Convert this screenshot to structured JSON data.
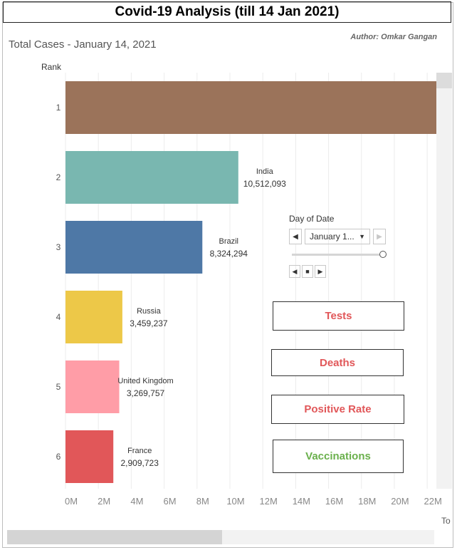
{
  "header": {
    "title": "Covid-19 Analysis (till 14 Jan 2021)",
    "author": "Author: Omkar Gangan",
    "subtitle": "Total Cases - January 14, 2021"
  },
  "chart_data": {
    "type": "bar",
    "orientation": "horizontal",
    "y_axis_title": "Rank",
    "categories": [
      "1",
      "2",
      "3",
      "4",
      "5",
      "6"
    ],
    "labels": [
      "",
      "India",
      "Brazil",
      "Russia",
      "United Kingdom",
      "France"
    ],
    "value_labels": [
      "",
      "10,512,093",
      "8,324,294",
      "3,459,237",
      "3,269,757",
      "2,909,723"
    ],
    "values": [
      23500000,
      10512093,
      8324294,
      3459237,
      3269757,
      2909723
    ],
    "colors": [
      "#9b735a",
      "#79b7b0",
      "#4e78a6",
      "#edc848",
      "#ff9da7",
      "#e15759"
    ],
    "x_ticks": [
      "0M",
      "2M",
      "4M",
      "6M",
      "8M",
      "10M",
      "12M",
      "14M",
      "16M",
      "18M",
      "20M",
      "22M"
    ],
    "xlim": [
      0,
      22600000
    ],
    "grid": "vertical"
  },
  "axis_cut_label": "To",
  "day_of_date": {
    "label": "Day of Date",
    "selected": "January 1...",
    "prev_icon": "chevron-left-icon",
    "next_icon": "chevron-right-icon",
    "slider_value_fraction": 1.0
  },
  "playback": {
    "back_icon": "step-back-icon",
    "stop_icon": "stop-icon",
    "play_icon": "play-icon"
  },
  "nav_buttons": {
    "tests": {
      "label": "Tests",
      "color": "#e15759"
    },
    "deaths": {
      "label": "Deaths",
      "color": "#e15759"
    },
    "positive_rate": {
      "label": "Positive Rate",
      "color": "#e15759"
    },
    "vaccinations": {
      "label": "Vaccinations",
      "color": "#6ab04c"
    }
  }
}
